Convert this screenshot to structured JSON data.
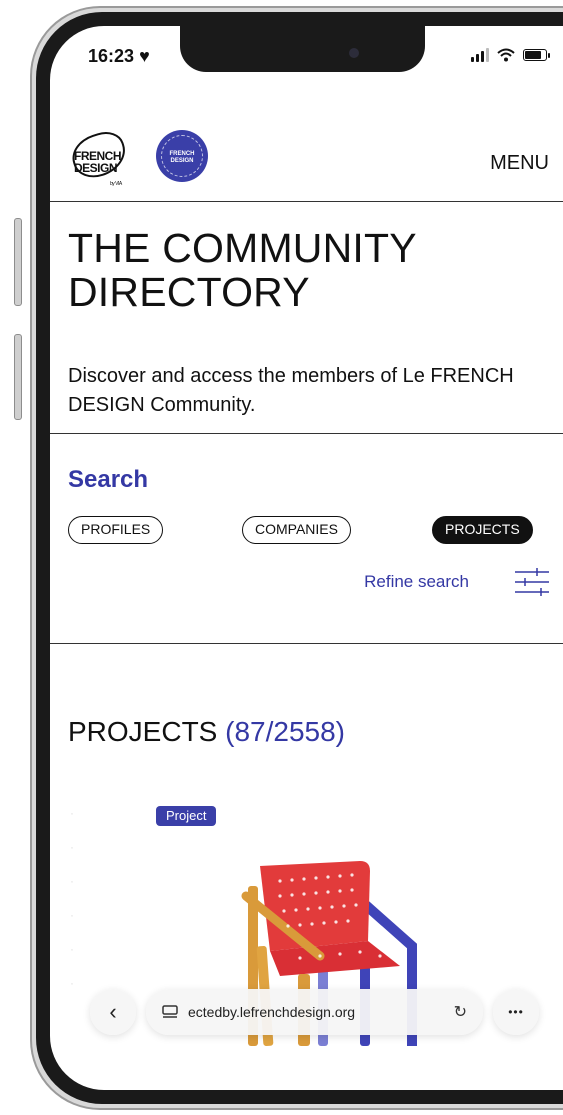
{
  "status_bar": {
    "time": "16:23",
    "heart": "♥",
    "signal_icon": "signal-icon",
    "wifi_icon": "wifi-icon",
    "battery_icon": "battery-icon"
  },
  "header": {
    "logo_line1": "FRENCH",
    "logo_line2": "DESIGN",
    "logo_tagline": "by VIA",
    "badge_text_line1": "FRENCH",
    "badge_text_line2": "DESIGN",
    "menu_label": "MENU"
  },
  "intro": {
    "title_line1": "THE COMMUNITY",
    "title_line2": "DIRECTORY",
    "description": "Discover and access the members of Le FRENCH DESIGN Community."
  },
  "search": {
    "heading": "Search",
    "tabs": [
      {
        "label": "PROFILES",
        "active": false
      },
      {
        "label": "COMPANIES",
        "active": false
      },
      {
        "label": "PROJECTS",
        "active": true
      }
    ],
    "refine_label": "Refine search"
  },
  "results": {
    "heading": "PROJECTS",
    "count": "(87/2558)",
    "card_badge": "Project"
  },
  "browser": {
    "url": "ectedby.lefrenchdesign.org",
    "back_glyph": "‹",
    "reload_glyph": "↻",
    "more_glyph": "•••"
  },
  "colors": {
    "accent": "#3438a4",
    "badge": "#3a3fa8",
    "chair_seat": "#e23b3b",
    "chair_frame_blue": "#3f44b8",
    "chair_wood": "#d99a3a"
  }
}
